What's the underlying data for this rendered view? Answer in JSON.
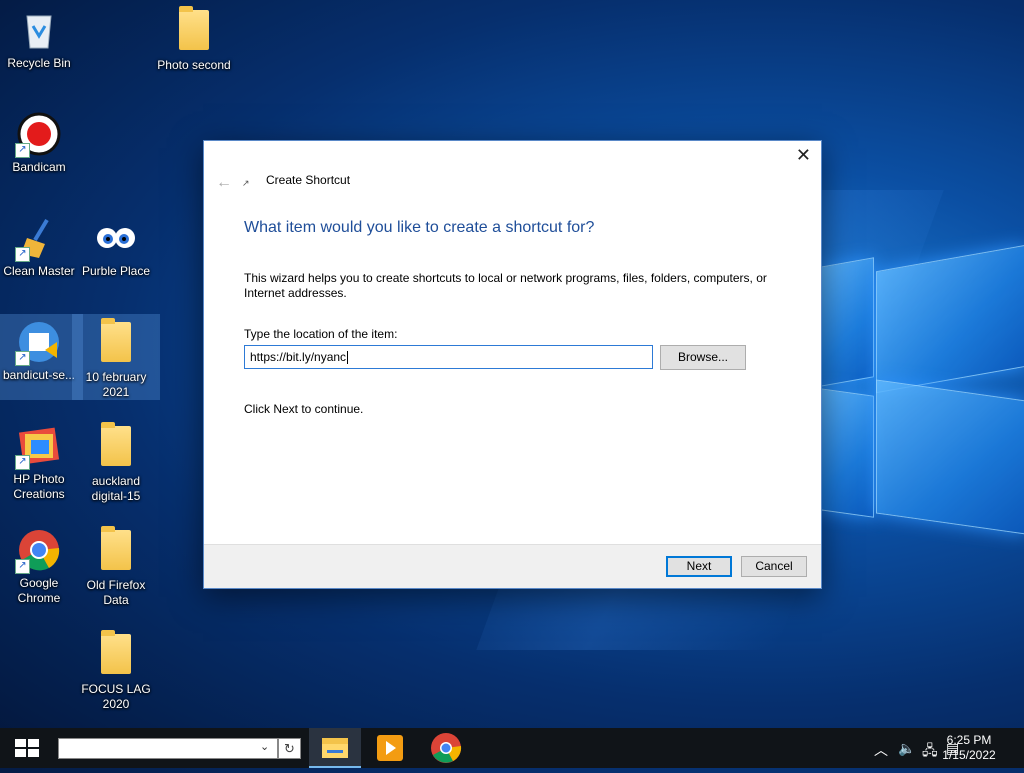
{
  "desktop": {
    "icons": [
      {
        "label": "Recycle Bin"
      },
      {
        "label": "Photo second"
      },
      {
        "label": "Bandicam"
      },
      {
        "label": "Clean Master"
      },
      {
        "label": "Purble Place"
      },
      {
        "label": "bandicut-se..."
      },
      {
        "label": "10 february 2021"
      },
      {
        "label": "HP Photo Creations"
      },
      {
        "label": "auckland digital-15"
      },
      {
        "label": "Google Chrome"
      },
      {
        "label": "Old Firefox Data"
      },
      {
        "label": "FOCUS LAG 2020"
      }
    ]
  },
  "dialog": {
    "title": "Create Shortcut",
    "heading": "What item would you like to create a shortcut for?",
    "description": "This wizard helps you to create shortcuts to local or network programs, files, folders, computers, or Internet addresses.",
    "location_label": "Type the location of the item:",
    "location_value": "https://bit.ly/nyanc",
    "browse_label": "Browse...",
    "hint": "Click Next to continue.",
    "next_label": "Next",
    "cancel_label": "Cancel"
  },
  "taskbar": {
    "clock_time": "6:25 PM",
    "clock_date": "1/15/2022",
    "apps": [
      "file-explorer-icon",
      "media-player-icon",
      "chrome-icon"
    ]
  },
  "colors": {
    "heading_blue": "#1f4e99",
    "focus_blue": "#0078d7"
  }
}
